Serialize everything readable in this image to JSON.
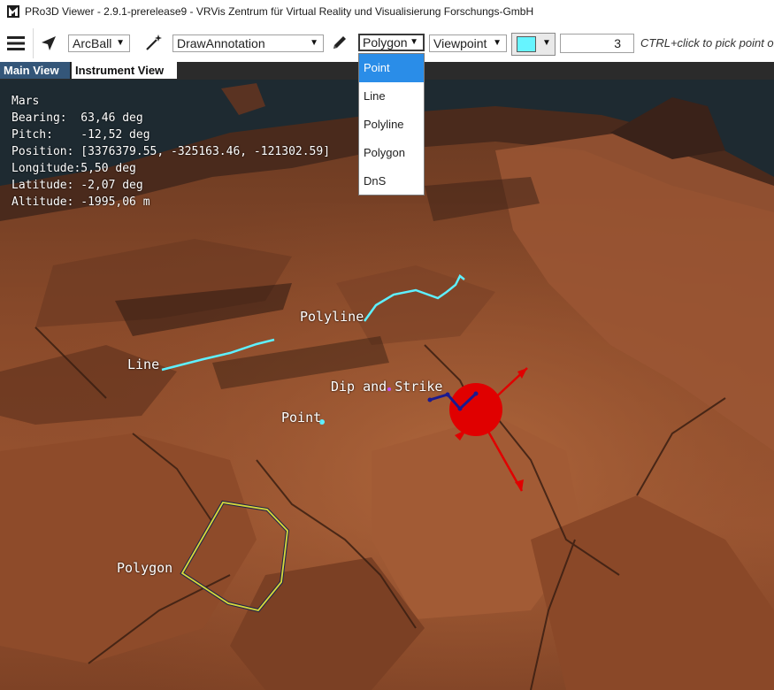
{
  "window": {
    "title": "PRo3D Viewer - 2.9.1-prerelease9 - VRVis Zentrum für Virtual Reality und Visualisierung Forschungs-GmbH"
  },
  "toolbar": {
    "navigation_mode": "ArcBall",
    "interaction_mode": "DrawAnnotation",
    "geometry_type": "Polygon",
    "projection": "Viewpoint",
    "annotation_color": "#66f4ff",
    "thickness_value": "3",
    "hint": "CTRL+click to pick point on"
  },
  "tabs": {
    "main_view": "Main View",
    "instrument_view": "Instrument View"
  },
  "geometry_dropdown": {
    "options": [
      "Point",
      "Line",
      "Polyline",
      "Polygon",
      "DnS"
    ],
    "highlighted": "Point"
  },
  "info_overlay": {
    "planet": "Mars",
    "bearing": "Bearing:  63,46 deg",
    "pitch": "Pitch:    -12,52 deg",
    "position": "Position: [3376379.55, -325163.46, -121302.59]",
    "longitude": "Longitude:5,50 deg",
    "latitude": "Latitude: -2,07 deg",
    "altitude": "Altitude: -1995,06 m"
  },
  "annotations": {
    "polyline": "Polyline",
    "line": "Line",
    "dip_and_strike": "Dip and Strike",
    "point": "Point",
    "polygon": "Polygon"
  },
  "colors": {
    "annotation_cyan": "#5ef0ff",
    "polygon_outline": "#d8d83a",
    "dns_red": "#e00000",
    "tab_active": "#345679",
    "dropdown_highlight": "#2a8de8"
  }
}
